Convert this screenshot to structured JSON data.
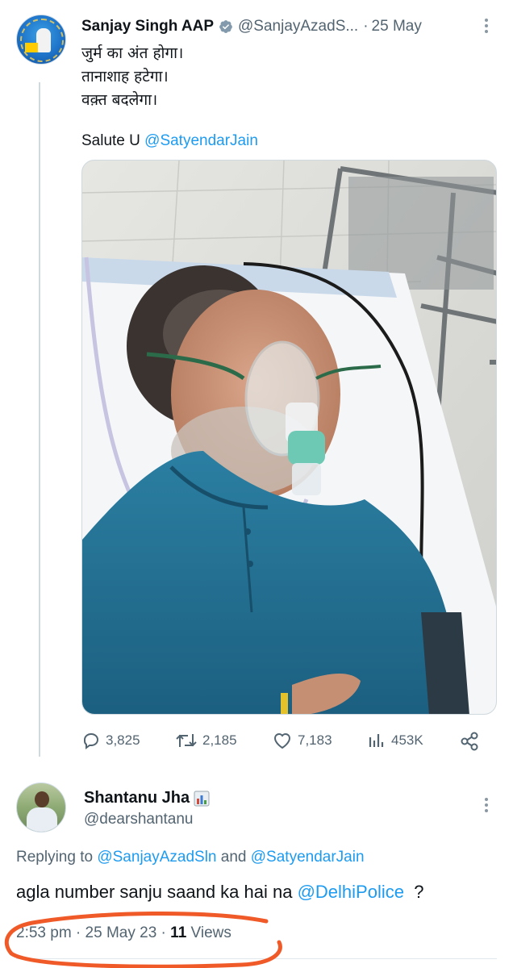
{
  "original_tweet": {
    "author_name": "Sanjay Singh AAP",
    "handle": "@SanjayAzadS...",
    "separator": "·",
    "date": "25 May",
    "lines": [
      "जुर्म का अंत होगा।",
      "तानाशाह हटेगा।",
      "वक़्त बदलेगा।"
    ],
    "salute_prefix": "Salute U ",
    "salute_mention": "@SatyendarJain",
    "stats": {
      "replies": "3,825",
      "retweets": "2,185",
      "likes": "7,183",
      "views": "453K"
    },
    "icons": {
      "verified": "verified-badge-icon",
      "more": "more-options-icon",
      "reply": "reply-icon",
      "retweet": "retweet-icon",
      "like": "heart-icon",
      "views": "views-chart-icon",
      "share": "share-icon"
    }
  },
  "reply_tweet": {
    "author_name": "Shantanu Jha",
    "handle": "@dearshantanu",
    "replying_prefix": "Replying to ",
    "replying_to_1": "@SanjayAzadSln",
    "replying_joiner": " and ",
    "replying_to_2": "@SatyendarJain",
    "text_prefix": "agla number sanju saand ka hai na ",
    "text_mention": "@DelhiPolice",
    "text_suffix": "  ?",
    "time": "2:53 pm",
    "dot1": " · ",
    "date": "25 May 23",
    "dot2": " · ",
    "view_count": "11",
    "view_label": " Views"
  },
  "colors": {
    "accent": "#1d9bf0",
    "muted": "#536471",
    "annotation": "#f05a28"
  }
}
